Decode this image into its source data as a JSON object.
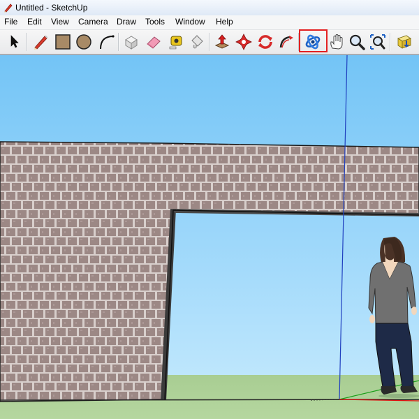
{
  "window": {
    "title": "Untitled - SketchUp"
  },
  "menu": [
    {
      "label": "File"
    },
    {
      "label": "Edit"
    },
    {
      "label": "View"
    },
    {
      "label": "Camera"
    },
    {
      "label": "Draw"
    },
    {
      "label": "Tools"
    },
    {
      "label": "Window"
    },
    {
      "label": "Help"
    }
  ],
  "toolbar": {
    "tools": [
      {
        "name": "select-tool",
        "icon": "arrow-cursor-icon"
      },
      {
        "name": "line-tool",
        "icon": "pencil-icon"
      },
      {
        "name": "rectangle-tool",
        "icon": "rectangle-icon"
      },
      {
        "name": "circle-tool",
        "icon": "circle-icon"
      },
      {
        "name": "arc-tool",
        "icon": "arc-icon"
      },
      {
        "name": "make-component-tool",
        "icon": "component-box-icon"
      },
      {
        "name": "eraser-tool",
        "icon": "eraser-icon"
      },
      {
        "name": "tape-measure-tool",
        "icon": "tape-measure-icon"
      },
      {
        "name": "paint-bucket-tool",
        "icon": "paint-bucket-icon"
      },
      {
        "name": "push-pull-tool",
        "icon": "push-pull-icon"
      },
      {
        "name": "move-tool",
        "icon": "move-arrows-icon"
      },
      {
        "name": "rotate-tool",
        "icon": "rotate-icon"
      },
      {
        "name": "follow-me-tool",
        "icon": "follow-me-icon"
      },
      {
        "name": "orbit-tool",
        "icon": "orbit-icon",
        "highlighted": true
      },
      {
        "name": "pan-tool",
        "icon": "hand-icon"
      },
      {
        "name": "zoom-tool",
        "icon": "magnifier-icon"
      },
      {
        "name": "zoom-extents-tool",
        "icon": "zoom-extents-icon"
      },
      {
        "name": "get-models-tool",
        "icon": "warehouse-icon"
      }
    ],
    "highlight_color": "#e32021"
  },
  "scene": {
    "sky_color": "#73c4f6",
    "ground_color": "#a9cd94",
    "wall_color": "#9c8885",
    "wall_mortar_color": "#d8cfcc",
    "blue_axis_color": "#1f3fbf",
    "green_axis_color": "#1aa01a",
    "red_axis_color": "#e01010"
  }
}
